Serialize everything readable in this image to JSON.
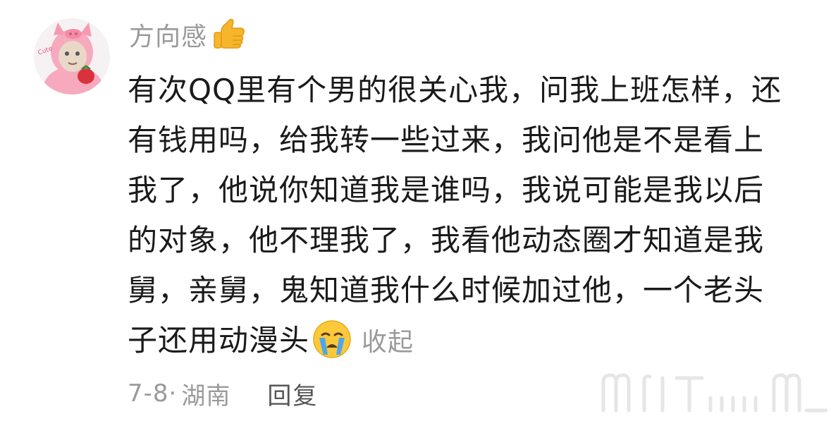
{
  "comment": {
    "username": "方向感",
    "badge_icon": "thumbs-up-hand-icon",
    "avatar_icon": "pig-costume-avatar",
    "body_lines": [
      "有次QQ里有个男的很关心我，问我上班怎样，还",
      "有钱用吗，给我转一些过来，我问他是不是看上",
      "我了，他说你知道我是谁吗，我说可能是我以后",
      "的对象，他不理我了，我看他动态圈才知道是我",
      "舅，亲舅，鬼知道我什么时候加过他，一个老头",
      "子还用动漫头"
    ],
    "inline_emoji": "crying-face-icon",
    "collapse_label": "收起",
    "date": "7-8·",
    "location": "湖南",
    "reply_label": "回复"
  },
  "colors": {
    "text": "#1a1a1a",
    "muted": "#9a9a9a",
    "reply": "#555555"
  }
}
